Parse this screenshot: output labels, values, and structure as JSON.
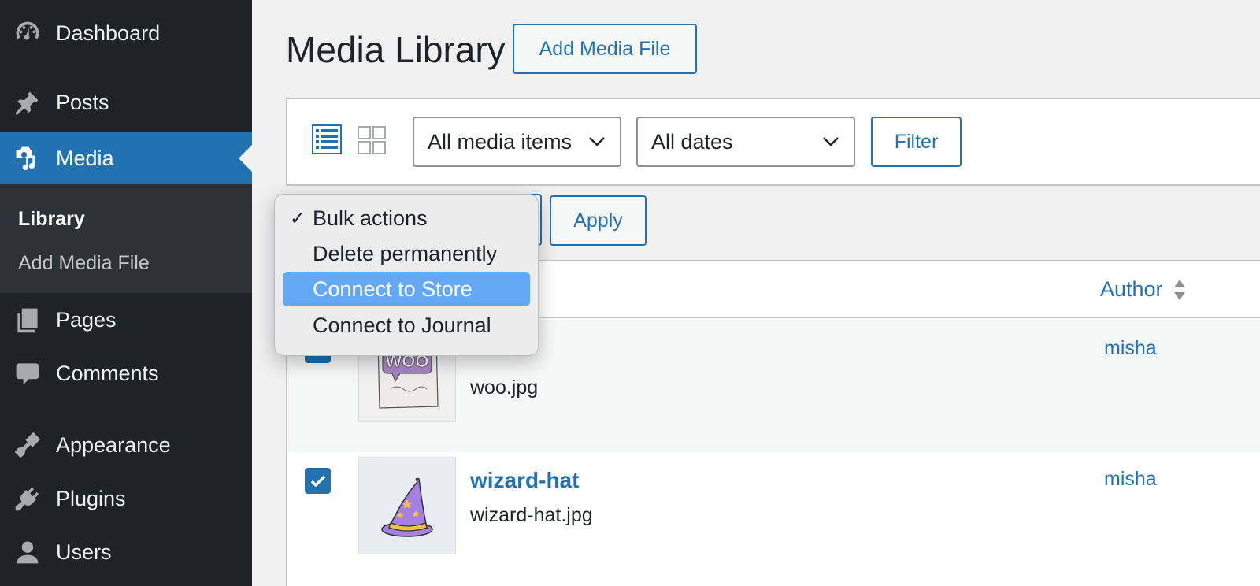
{
  "sidebar": {
    "items": [
      {
        "label": "Dashboard",
        "icon": "dashboard-icon"
      },
      {
        "label": "Posts",
        "icon": "pushpin-icon"
      },
      {
        "label": "Media",
        "icon": "media-icon"
      },
      {
        "label": "Pages",
        "icon": "pages-icon"
      },
      {
        "label": "Comments",
        "icon": "comment-icon"
      },
      {
        "label": "Appearance",
        "icon": "paintbrush-icon"
      },
      {
        "label": "Plugins",
        "icon": "plug-icon"
      },
      {
        "label": "Users",
        "icon": "user-icon"
      }
    ],
    "submenu": [
      {
        "label": "Library",
        "current": true
      },
      {
        "label": "Add Media File",
        "current": false
      }
    ]
  },
  "header": {
    "title": "Media Library",
    "add_button": "Add Media File"
  },
  "filters": {
    "media_type": "All media items",
    "dates": "All dates",
    "filter_button": "Filter"
  },
  "bulk": {
    "apply_button": "Apply",
    "options": [
      {
        "label": "Bulk actions",
        "checked": true
      },
      {
        "label": "Delete permanently",
        "checked": false
      },
      {
        "label": "Connect to Store",
        "highlighted": true
      },
      {
        "label": "Connect to Journal",
        "checked": false
      }
    ]
  },
  "table": {
    "author_header": "Author",
    "rows": [
      {
        "title": "",
        "file": "woo.jpg",
        "author": "misha",
        "checked": true,
        "thumb_text": "WOO"
      },
      {
        "title": "wizard-hat",
        "file": "wizard-hat.jpg",
        "author": "misha",
        "checked": true
      }
    ]
  },
  "colors": {
    "sidebar_bg": "#1d2327",
    "accent": "#2271b1",
    "highlight": "#64a8f5"
  }
}
